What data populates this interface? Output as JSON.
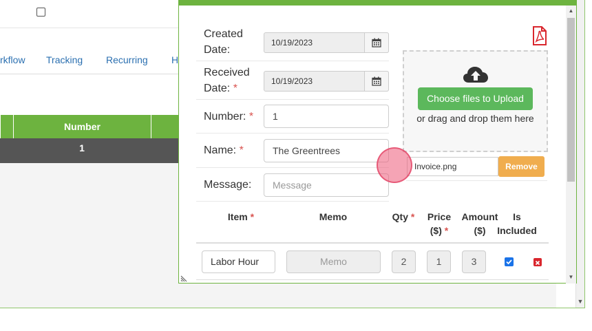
{
  "background": {
    "tabs": [
      "rkflow",
      "Tracking",
      "Recurring",
      "H"
    ],
    "table": {
      "header": "Number",
      "row_value": "1"
    }
  },
  "form": {
    "created_date": {
      "label_line1": "Created",
      "label_line2": "Date:",
      "value": "10/19/2023"
    },
    "received_date": {
      "label_line1": "Received",
      "label_line2": "Date:",
      "required": "*",
      "value": "10/19/2023"
    },
    "number": {
      "label": "Number:",
      "required": "*",
      "value": "1"
    },
    "name": {
      "label": "Name:",
      "required": "*",
      "value": "The Greentrees"
    },
    "message": {
      "label": "Message:",
      "placeholder": "Message"
    }
  },
  "upload": {
    "choose_label": "Choose files to Upload",
    "drop_text": "or drag and drop them here",
    "file_name": "Invoice.png",
    "remove_label": "Remove"
  },
  "items_table": {
    "headers": {
      "item": "Item",
      "item_req": "*",
      "memo": "Memo",
      "qty": "Qty",
      "qty_req": "*",
      "price_line1": "Price",
      "price_line2": "($)",
      "price_req": "*",
      "amount_line1": "Amount",
      "amount_line2": "($)",
      "included_line1": "Is",
      "included_line2": "Included"
    },
    "row": {
      "item": "Labor Hour",
      "memo_placeholder": "Memo",
      "qty": "2",
      "price": "1",
      "amount": "3",
      "included": true
    }
  },
  "colors": {
    "accent": "#6db33f",
    "upload_button": "#5cb85c",
    "remove_button": "#f0ad4e",
    "required": "#d9534f",
    "pdf_icon": "#d9262d"
  }
}
